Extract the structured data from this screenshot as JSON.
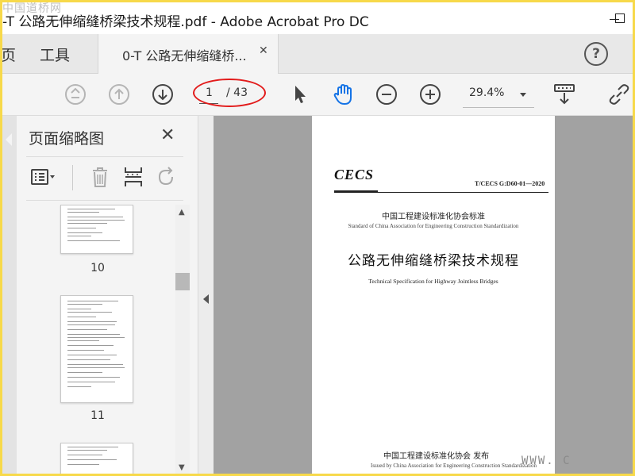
{
  "window": {
    "title": "-T 公路无伸缩缝桥梁技术规程.pdf - Adobe Acrobat Pro DC",
    "watermark_top": "中国道桥网"
  },
  "tabs": {
    "home": "页",
    "tools": "工具",
    "document": "0-T 公路无伸缩缝桥...",
    "help": "?"
  },
  "toolbar": {
    "page_current": "1",
    "page_total": "/ 43",
    "zoom": "29.4%",
    "icons": [
      "prev-page-up-icon",
      "arrow-up-icon",
      "arrow-down-icon",
      "select-arrow-icon",
      "hand-icon",
      "zoom-out-icon",
      "zoom-in-icon",
      "scroll-mode-icon",
      "link-icon"
    ]
  },
  "panel": {
    "title": "页面缩略图",
    "close": "✕",
    "thumbnails": [
      {
        "number": "10"
      },
      {
        "number": "11"
      }
    ]
  },
  "document": {
    "logo": "CECS",
    "code": "T/CECS G:D60-01—2020",
    "org_cn": "中国工程建设标准化协会标准",
    "org_en": "Standard of China Association for Engineering Construction Standardization",
    "title_cn": "公路无伸缩缝桥梁技术规程",
    "title_en": "Technical Specification for Highway Jointless Bridges",
    "issuer_cn": "中国工程建设标准化协会  发布",
    "issuer_en": "Issued by China Association for Engineering Construction Standardization"
  },
  "watermark_bottom": "WWW. C",
  "colors": {
    "frame_border": "#f7d94a",
    "accent_blue": "#1473e6",
    "annotation_red": "#e21b1b",
    "viewer_bg": "#a2a2a2"
  }
}
